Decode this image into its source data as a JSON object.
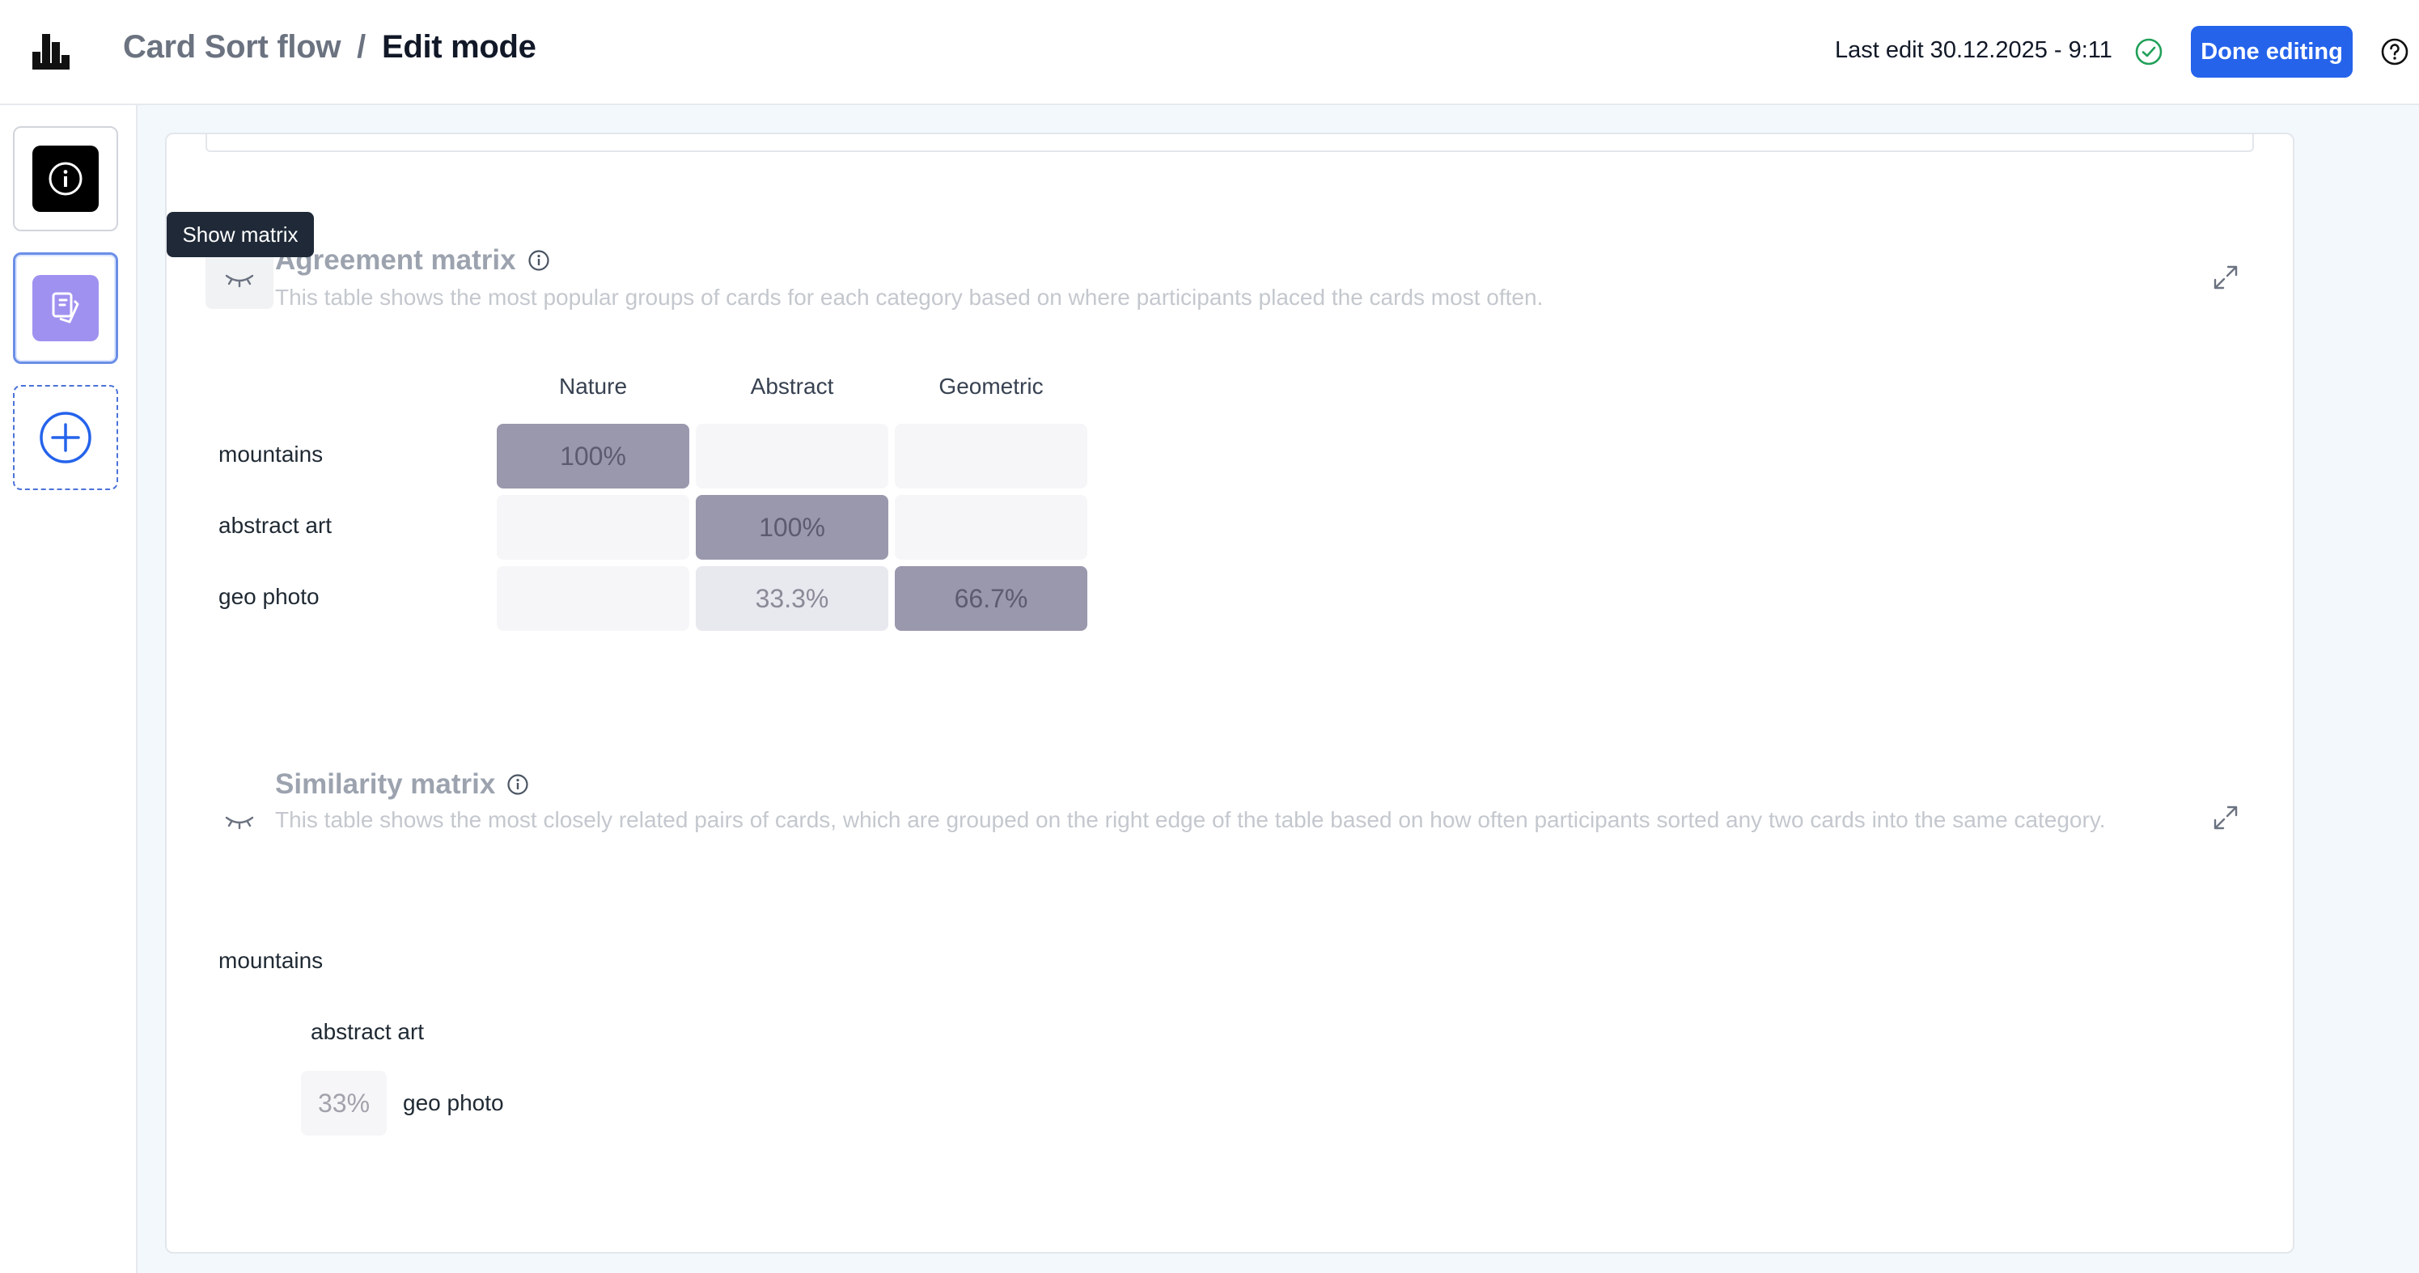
{
  "header": {
    "breadcrumb_parent": "Card Sort flow",
    "breadcrumb_separator": "/",
    "breadcrumb_current": "Edit mode",
    "last_edit": "Last edit 30.12.2025 - 9:11",
    "done_label": "Done editing",
    "icons": {
      "logo": "bars-logo-icon",
      "saved": "check-circle-icon",
      "help": "question-circle-icon"
    }
  },
  "sidebar": {
    "items": [
      {
        "name": "info-block",
        "icon": "info-icon"
      },
      {
        "name": "card-sort-block",
        "icon": "cards-icon",
        "selected": true
      },
      {
        "name": "add-block",
        "icon": "plus-circle-icon"
      }
    ]
  },
  "tooltip": {
    "text": "Show matrix"
  },
  "agreement": {
    "title": "Agreement matrix",
    "description": "This table shows the most popular groups of cards for each category based on where participants placed the cards most often.",
    "columns": [
      "Nature",
      "Abstract",
      "Geometric"
    ],
    "rows": [
      {
        "label": "mountains",
        "values": [
          "100%",
          "",
          ""
        ]
      },
      {
        "label": "abstract art",
        "values": [
          "",
          "100%",
          ""
        ]
      },
      {
        "label": "geo photo",
        "values": [
          "",
          "33.3%",
          "66.7%"
        ]
      }
    ]
  },
  "similarity": {
    "title": "Similarity matrix",
    "description": "This table shows the most closely related pairs of cards, which are grouped on the right edge of the table based on how often participants sorted any two cards into the same category.",
    "cards": [
      "mountains",
      "abstract art",
      "geo photo"
    ],
    "pair_value": "33%"
  },
  "colors": {
    "accent": "#2563eb",
    "strong_cell": "#9a98ad",
    "weak_cell": "#e8e8ef",
    "tooltip_bg": "#1f2937"
  }
}
